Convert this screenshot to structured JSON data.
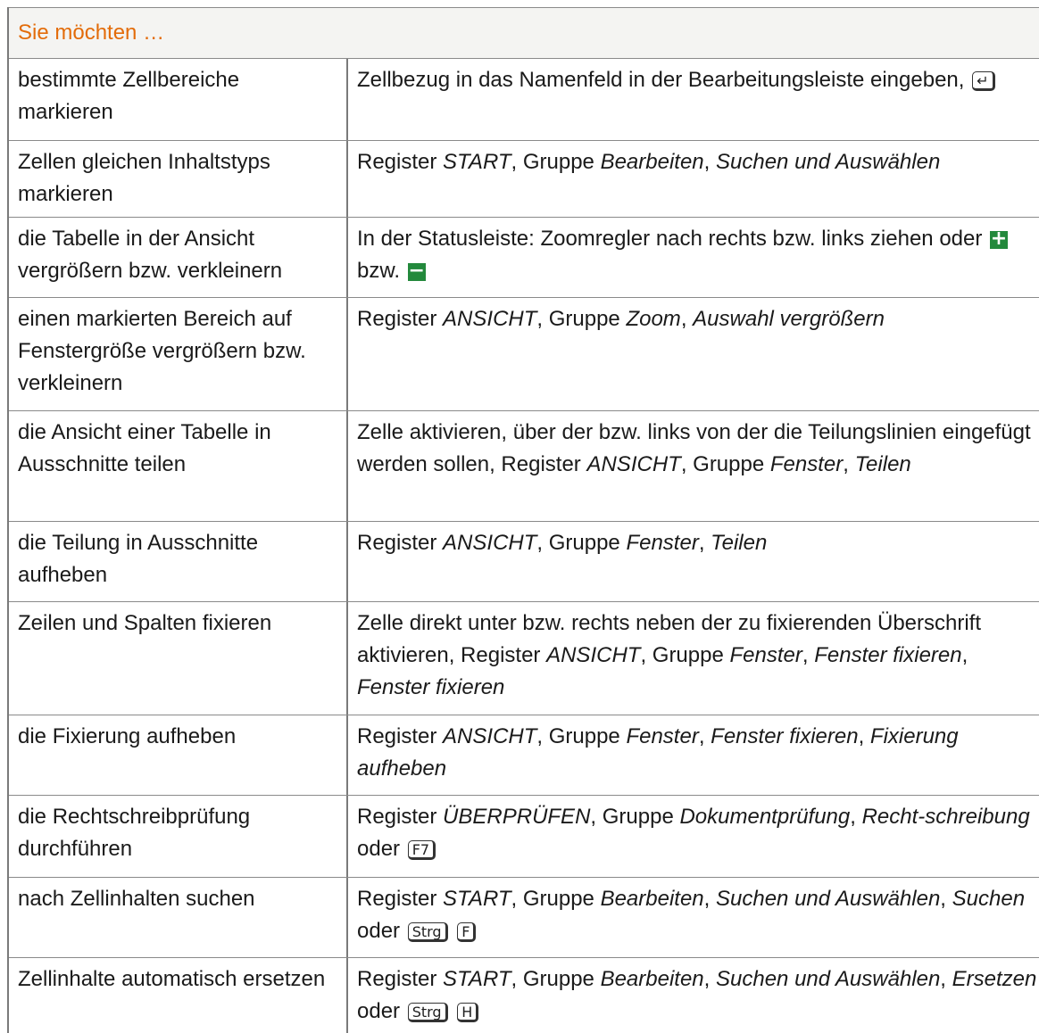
{
  "header": {
    "title": "Sie möchten …"
  },
  "rows": [
    {
      "left": "bestimmte Zellbereiche markieren",
      "right": [
        {
          "t": "Zellbezug in das Namenfeld in der Bearbeitungsleiste eingeben, "
        },
        {
          "k": "↵",
          "n": "enter-key-icon"
        }
      ]
    },
    {
      "left": "Zellen gleichen Inhaltstyps markieren",
      "right": [
        {
          "t": "Register "
        },
        {
          "i": "START"
        },
        {
          "t": ", Gruppe "
        },
        {
          "i": "Bearbeiten"
        },
        {
          "t": ", "
        },
        {
          "i": "Suchen und Auswählen"
        }
      ]
    },
    {
      "left": "die Tabelle in der Ansicht vergrößern bzw. verkleinern",
      "right": [
        {
          "t": "In der Statusleiste: Zoomregler nach rechts bzw. links ziehen oder "
        },
        {
          "p": "+",
          "n": "zoom-in-icon"
        },
        {
          "t": " bzw. "
        },
        {
          "p": "−",
          "n": "zoom-out-icon"
        }
      ]
    },
    {
      "left": "einen markierten Bereich auf Fenstergröße vergrößern bzw. verkleinern",
      "right": [
        {
          "t": "Register "
        },
        {
          "i": "ANSICHT"
        },
        {
          "t": ", Gruppe "
        },
        {
          "i": "Zoom"
        },
        {
          "t": ", "
        },
        {
          "i": "Auswahl vergrößern"
        }
      ]
    },
    {
      "left": "die Ansicht einer Tabelle in Ausschnitte teilen",
      "right": [
        {
          "t": "Zelle aktivieren, über der bzw. links von der die Teilungslinien eingefügt werden sollen, Register "
        },
        {
          "i": "ANSICHT"
        },
        {
          "t": ", Gruppe "
        },
        {
          "i": "Fenster"
        },
        {
          "t": ", "
        },
        {
          "i": "Teilen"
        }
      ]
    },
    {
      "left": "die Teilung in Ausschnitte aufheben",
      "right": [
        {
          "t": "Register "
        },
        {
          "i": "ANSICHT"
        },
        {
          "t": ", Gruppe "
        },
        {
          "i": "Fenster"
        },
        {
          "t": ", "
        },
        {
          "i": "Teilen"
        }
      ]
    },
    {
      "left": "Zeilen und Spalten fixieren",
      "right": [
        {
          "t": "Zelle direkt unter bzw. rechts neben der zu fixierenden Überschrift aktivieren, Register "
        },
        {
          "i": "ANSICHT"
        },
        {
          "t": ", Gruppe "
        },
        {
          "i": "Fenster"
        },
        {
          "t": ", "
        },
        {
          "i": "Fenster fixieren"
        },
        {
          "t": ", "
        },
        {
          "i": "Fenster fixieren"
        }
      ]
    },
    {
      "left": "die Fixierung aufheben",
      "right": [
        {
          "t": "Register "
        },
        {
          "i": "ANSICHT"
        },
        {
          "t": ", Gruppe "
        },
        {
          "i": "Fenster"
        },
        {
          "t": ", "
        },
        {
          "i": "Fenster fixieren"
        },
        {
          "t": ", "
        },
        {
          "i": "Fixierung aufheben"
        }
      ]
    },
    {
      "left": "die Rechtschreibprüfung durchführen",
      "right": [
        {
          "t": "Register "
        },
        {
          "i": "ÜBERPRÜFEN"
        },
        {
          "t": ", Gruppe "
        },
        {
          "i": "Dokumentprüfung"
        },
        {
          "t": ", "
        },
        {
          "i": "Recht-schreibung"
        },
        {
          "t": " oder "
        },
        {
          "k": "F7",
          "n": "f7-key-icon"
        }
      ]
    },
    {
      "left": "nach Zellinhalten suchen",
      "right": [
        {
          "t": "Register "
        },
        {
          "i": "START"
        },
        {
          "t": ", Gruppe "
        },
        {
          "i": "Bearbeiten"
        },
        {
          "t": ", "
        },
        {
          "i": "Suchen und Auswählen"
        },
        {
          "t": ", "
        },
        {
          "i": "Suchen"
        },
        {
          "t": " oder "
        },
        {
          "k": "Strg",
          "n": "strg-key-icon"
        },
        {
          "t": " "
        },
        {
          "k": "F",
          "n": "f-key-icon"
        }
      ]
    },
    {
      "left": "Zellinhalte automatisch ersetzen",
      "right": [
        {
          "t": "Register "
        },
        {
          "i": "START"
        },
        {
          "t": ", Gruppe "
        },
        {
          "i": "Bearbeiten"
        },
        {
          "t": ", "
        },
        {
          "i": "Suchen und Auswählen"
        },
        {
          "t": ", "
        },
        {
          "i": "Ersetzen"
        },
        {
          "t": " oder "
        },
        {
          "k": "Strg",
          "n": "strg-key-icon"
        },
        {
          "t": " "
        },
        {
          "k": "H",
          "n": "h-key-icon"
        }
      ]
    }
  ]
}
